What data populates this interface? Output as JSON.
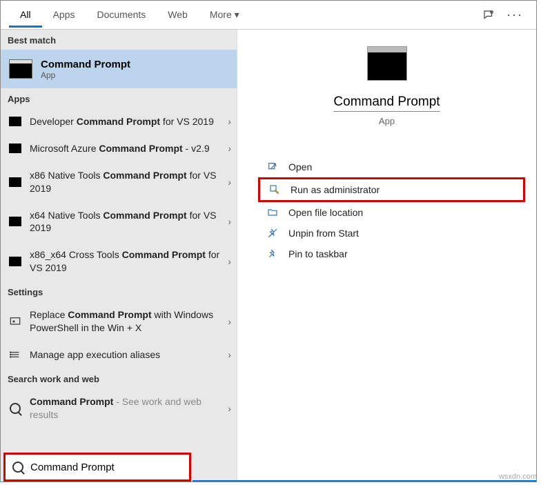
{
  "header": {
    "tabs": [
      "All",
      "Apps",
      "Documents",
      "Web",
      "More"
    ],
    "selected": 0
  },
  "sections": {
    "best": "Best match",
    "apps": "Apps",
    "settings": "Settings",
    "web": "Search work and web"
  },
  "bestMatch": {
    "title": "Command Prompt",
    "subtitle": "App"
  },
  "apps": [
    {
      "pre": "Developer ",
      "bold": "Command Prompt",
      "post": " for VS 2019"
    },
    {
      "pre": "Microsoft Azure ",
      "bold": "Command Prompt",
      "post": " - v2.9"
    },
    {
      "pre": "x86 Native Tools ",
      "bold": "Command Prompt",
      "post": " for VS 2019"
    },
    {
      "pre": "x64 Native Tools ",
      "bold": "Command Prompt",
      "post": " for VS 2019"
    },
    {
      "pre": "x86_x64 Cross Tools ",
      "bold": "Command Prompt",
      "post": " for VS 2019"
    }
  ],
  "settings": [
    {
      "pre": "Replace ",
      "bold": "Command Prompt",
      "post": " with Windows PowerShell in the Win + X",
      "icon": "swap"
    },
    {
      "pre": "",
      "bold": "",
      "post": "Manage app execution aliases",
      "icon": "list"
    }
  ],
  "webResults": [
    {
      "pre": "",
      "bold": "Command Prompt",
      "post": "",
      "hint": " - See work and web results",
      "icon": "search"
    }
  ],
  "detail": {
    "title": "Command Prompt",
    "subtitle": "App",
    "actions": [
      {
        "label": "Open",
        "icon": "open",
        "hl": false
      },
      {
        "label": "Run as administrator",
        "icon": "admin",
        "hl": true
      },
      {
        "label": "Open file location",
        "icon": "folder",
        "hl": false
      },
      {
        "label": "Unpin from Start",
        "icon": "unpin",
        "hl": false
      },
      {
        "label": "Pin to taskbar",
        "icon": "pin",
        "hl": false
      }
    ]
  },
  "search": {
    "value": "Command Prompt"
  },
  "watermark": "wsxdn.com"
}
